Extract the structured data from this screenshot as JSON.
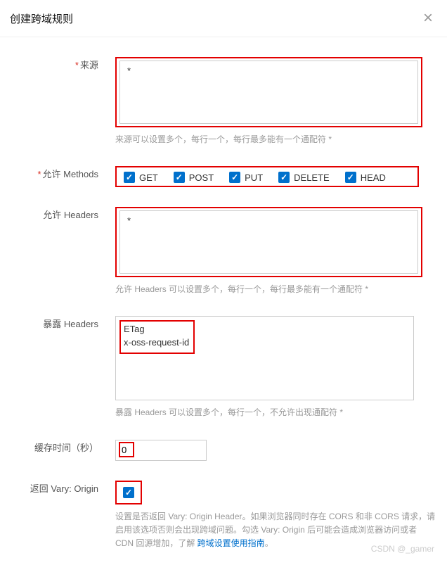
{
  "header": {
    "title": "创建跨域规则"
  },
  "form": {
    "source": {
      "label": "来源",
      "value": "*",
      "help": "来源可以设置多个，每行一个，每行最多能有一个通配符 *"
    },
    "methods": {
      "label": "允许 Methods",
      "options": [
        "GET",
        "POST",
        "PUT",
        "DELETE",
        "HEAD"
      ],
      "checked": {
        "GET": true,
        "POST": true,
        "PUT": true,
        "DELETE": true,
        "HEAD": true
      }
    },
    "headers_allow": {
      "label": "允许 Headers",
      "value": "*",
      "help": "允许 Headers 可以设置多个，每行一个，每行最多能有一个通配符 *"
    },
    "headers_expose": {
      "label": "暴露 Headers",
      "value": "ETag\nx-oss-request-id",
      "help": "暴露 Headers 可以设置多个，每行一个，不允许出现通配符 *"
    },
    "maxage": {
      "label": "缓存时间（秒）",
      "value": "0"
    },
    "vary": {
      "label": "返回 Vary: Origin",
      "checked": true,
      "help_prefix": "设置是否返回 Vary: Origin Header。如果浏览器同时存在 CORS 和非 CORS 请求，请启用该选项否则会出现跨域问题。勾选 Vary: Origin 后可能会造成浏览器访问或者 CDN 回源增加，了解 ",
      "help_link": "跨域设置使用指南",
      "help_suffix": "。"
    }
  },
  "watermark": "CSDN @_gamer"
}
